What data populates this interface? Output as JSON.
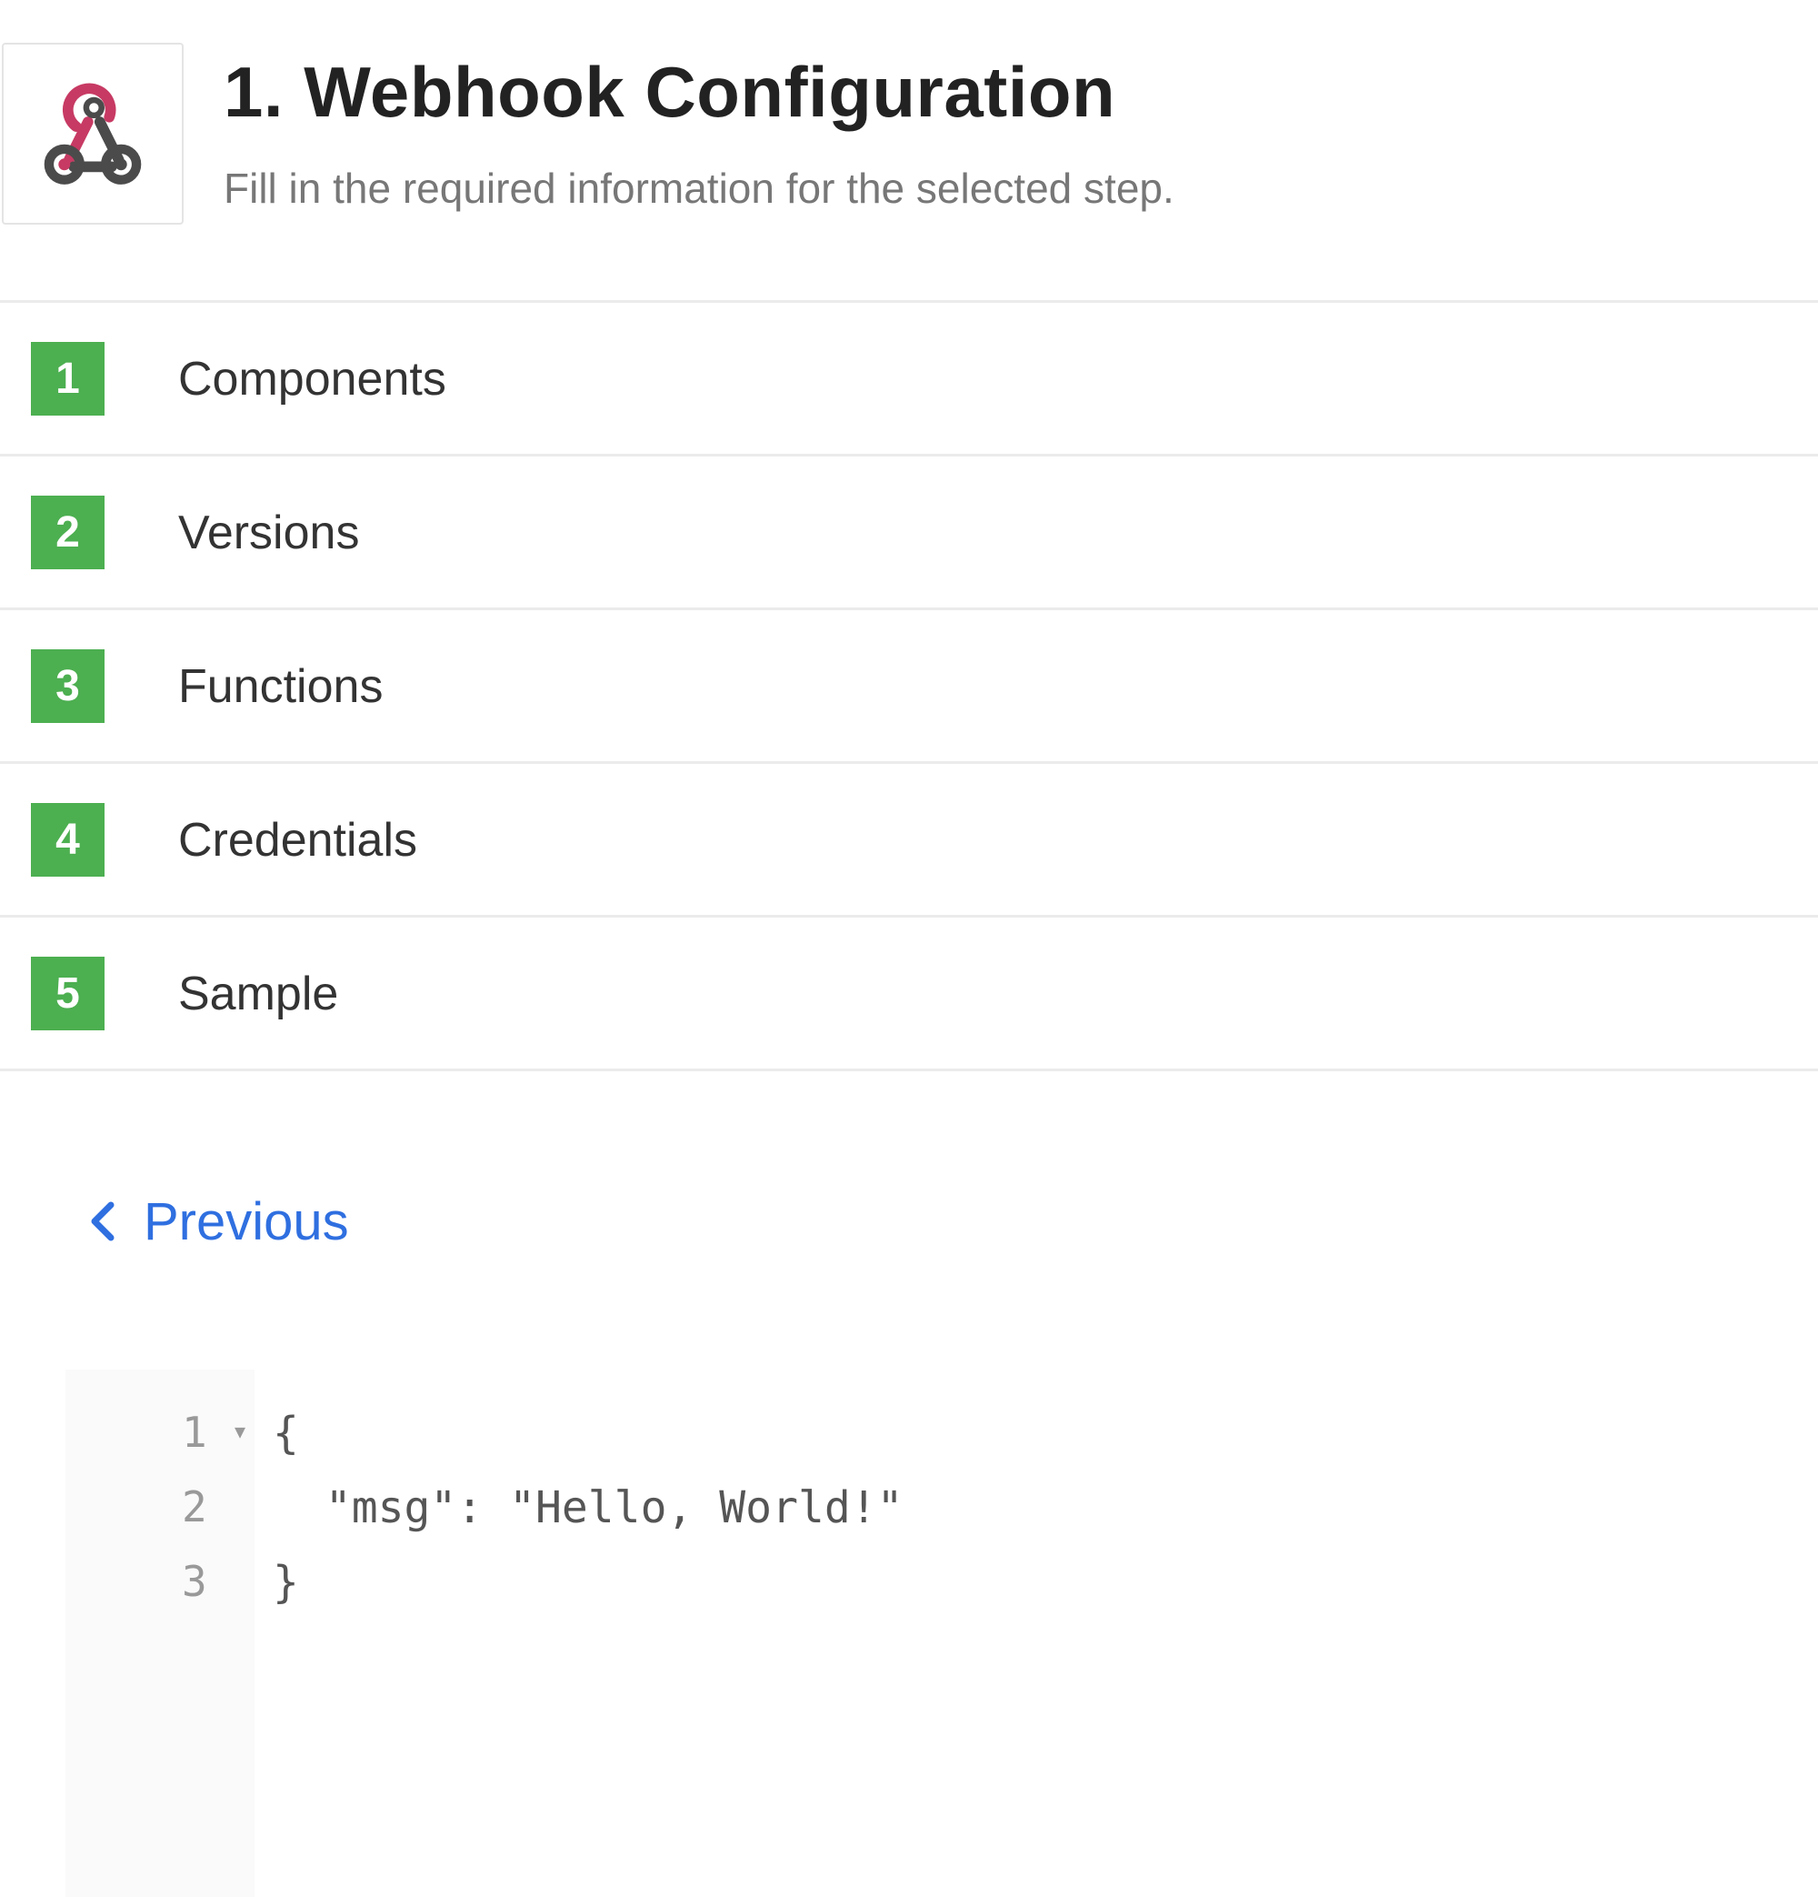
{
  "header": {
    "title": "1. Webhook Configuration",
    "subtitle": "Fill in the required information for the selected step.",
    "logo_icon": "webhook-icon"
  },
  "steps": [
    {
      "number": "1",
      "label": "Components"
    },
    {
      "number": "2",
      "label": "Versions"
    },
    {
      "number": "3",
      "label": "Functions"
    },
    {
      "number": "4",
      "label": "Credentials"
    },
    {
      "number": "5",
      "label": "Sample"
    }
  ],
  "navigation": {
    "previous_label": "Previous",
    "previous_icon": "chevron-left-icon"
  },
  "editor": {
    "lines": [
      {
        "number": "1",
        "text": "{"
      },
      {
        "number": "2",
        "text": "  \"msg\": \"Hello, World!\""
      },
      {
        "number": "3",
        "text": "}"
      }
    ]
  },
  "colors": {
    "step_badge": "#4caf50",
    "link": "#2f6fe0",
    "webhook_pink": "#c73a63",
    "webhook_dark": "#4b4b4b"
  }
}
